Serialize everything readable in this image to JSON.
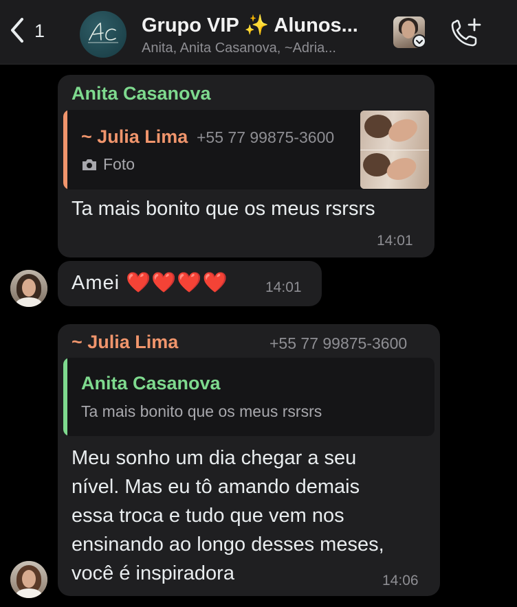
{
  "header": {
    "back_count": "1",
    "title": "Grupo VIP ✨ Alunos...",
    "subtitle": "Anita, Anita Casanova, ~Adria..."
  },
  "messages": [
    {
      "sender": "Anita Casanova",
      "quote": {
        "sender": "~ Julia Lima",
        "phone": "+55 77 99875-3600",
        "media_label": "Foto"
      },
      "text": "Ta mais bonito que os meus rsrsrs",
      "time": "14:01"
    },
    {
      "text": "Amei ❤️❤️❤️❤️",
      "time": "14:01"
    },
    {
      "sender": "~ Julia Lima",
      "phone": "+55 77 99875-3600",
      "quote": {
        "sender": "Anita Casanova",
        "text": "Ta mais bonito que os meus rsrsrs"
      },
      "text_lines": [
        "Meu sonho um dia chegar a seu",
        "nível. Mas eu tô amando demais",
        "essa troca e tudo que vem nos",
        "ensinando ao longo desses meses,",
        "você é inspiradora"
      ],
      "time": "14:06"
    }
  ],
  "colors": {
    "accent_green": "#7ed98e",
    "accent_orange": "#f0956c",
    "bubble": "#1f1f21"
  },
  "icons": [
    "chevron-left-icon",
    "camera-icon",
    "add-call-icon",
    "chevron-down-icon"
  ]
}
